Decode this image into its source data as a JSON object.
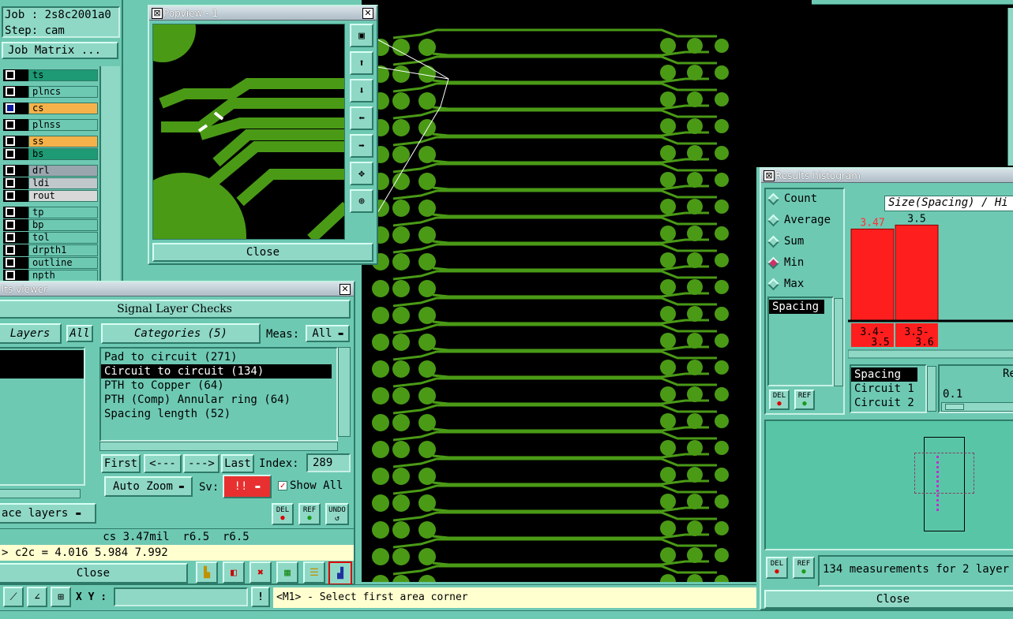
{
  "job": {
    "job_label": "Job : 2s8c2001a0",
    "step_label": "Step: cam",
    "job_matrix": "Job Matrix ..."
  },
  "layers": [
    {
      "name": "ts",
      "color": "#1e9a74"
    },
    {
      "name": "plncs",
      "color": "#6ec9b3"
    },
    {
      "name": "cs",
      "color": "#f6b24a"
    },
    {
      "name": "plnss",
      "color": "#6ec9b3"
    },
    {
      "name": "ss",
      "color": "#f6b24a"
    },
    {
      "name": "bs",
      "color": "#1e9a74"
    },
    {
      "name": "drl",
      "color": "#9aa6ae"
    },
    {
      "name": "ldi",
      "color": "#c0c8cc"
    },
    {
      "name": "rout",
      "color": "#d8d8d8"
    },
    {
      "name": "tp",
      "color": "#6ec9b3"
    },
    {
      "name": "bp",
      "color": "#6ec9b3"
    },
    {
      "name": "tol",
      "color": "#6ec9b3"
    },
    {
      "name": "drpth1",
      "color": "#6ec9b3"
    },
    {
      "name": "outline",
      "color": "#6ec9b3"
    },
    {
      "name": "npth",
      "color": "#6ec9b3"
    }
  ],
  "popview": {
    "title": "Popview - 1",
    "close": "Close"
  },
  "results_viewer": {
    "title": "lts viewer",
    "header": "Signal Layer Checks",
    "layers_tab": "Layers",
    "all_btn": "All",
    "categories_tab": "Categories (5)",
    "meas_label": "Meas:",
    "meas_value": "All",
    "categories": [
      "Pad to circuit (271)",
      "Circuit to circuit (134)",
      "PTH to Copper (64)",
      "PTH (Comp) Annular ring (64)",
      "Spacing length (52)"
    ],
    "selected_index": 1,
    "nav": {
      "first": "First",
      "prev": "<---",
      "next": "--->",
      "last": "Last",
      "index_label": "Index:",
      "index_value": "289"
    },
    "auto_zoom": "Auto Zoom",
    "sv_label": "Sv:",
    "sv_value": "!!",
    "show_all": "Show All",
    "replace_layers": "ace layers",
    "del": "DEL",
    "ref": "REF",
    "undo": "UNDO",
    "status1": "cs 3.47mil  r6.5  r6.5",
    "status2": "> c2c = 4.016 5.984 7.992",
    "close": "Close"
  },
  "histogram": {
    "title": "Results histogram",
    "chart_title": "Size(Spacing) / Hi",
    "options": [
      "Count",
      "Average",
      "Sum",
      "Min",
      "Max"
    ],
    "selected_option": "Min",
    "field": "Spacing",
    "field_list": [
      "Spacing",
      "Circuit 1",
      "Circuit 2"
    ],
    "res_label": "Res",
    "res_value": "0.1",
    "del": "DEL",
    "ref": "REF",
    "summary": "134 measurements for 2 layer",
    "close": "Close"
  },
  "chart_data": {
    "type": "bar",
    "categories": [
      "3.4-3.5",
      "3.5-3.6"
    ],
    "tick_top": [
      "3.4-",
      "3.5-"
    ],
    "tick_bottom": [
      "3.5",
      "3.6"
    ],
    "values": [
      3.47,
      3.5
    ],
    "value_labels": [
      "3.47",
      "3.5"
    ],
    "value_label_colors": [
      "#ff3030",
      "#000000"
    ],
    "bar_color": "#ff1e1e"
  },
  "bottom": {
    "xy_label": "X Y :",
    "xy_value": "",
    "prompt": "<M1> - Select first area corner"
  }
}
